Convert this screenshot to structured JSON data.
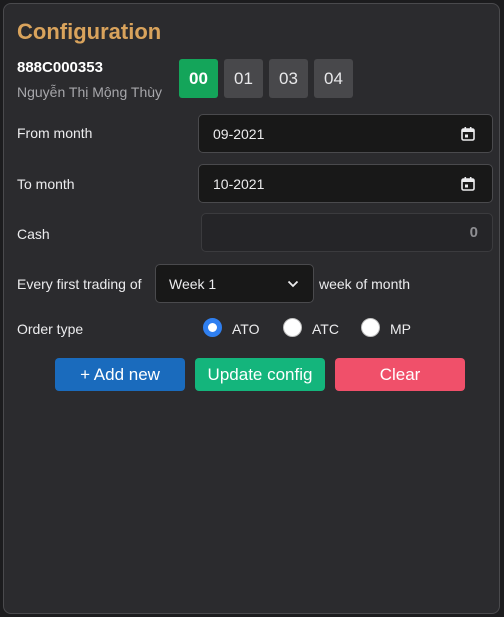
{
  "title": "Configuration",
  "account": {
    "id": "888C000353",
    "name": "Nguyễn Thị Mộng Thùy"
  },
  "sub_accounts": [
    "00",
    "01",
    "03",
    "04"
  ],
  "active_sub_account": "00",
  "fields": {
    "from_month": {
      "label": "From month",
      "value": "09-2021",
      "icon": "calendar-icon"
    },
    "to_month": {
      "label": "To month",
      "value": "10-2021",
      "icon": "calendar-icon"
    },
    "cash": {
      "label": "Cash",
      "placeholder": "0"
    }
  },
  "schedule": {
    "prefix": "Every first trading of",
    "selected": "Week 1",
    "suffix": "week of month"
  },
  "order_type": {
    "label": "Order type",
    "options": [
      "ATO",
      "ATC",
      "MP"
    ],
    "selected": "ATO"
  },
  "buttons": {
    "add_new": "+ Add new",
    "update": "Update config",
    "clear": "Clear"
  },
  "colors": {
    "title": "#d9a35c",
    "active_sub": "#14a55a",
    "add_button": "#1a6bbd",
    "update_button": "#14b57c",
    "clear_button": "#f0506a",
    "radio_selected": "#2f7ff0"
  }
}
